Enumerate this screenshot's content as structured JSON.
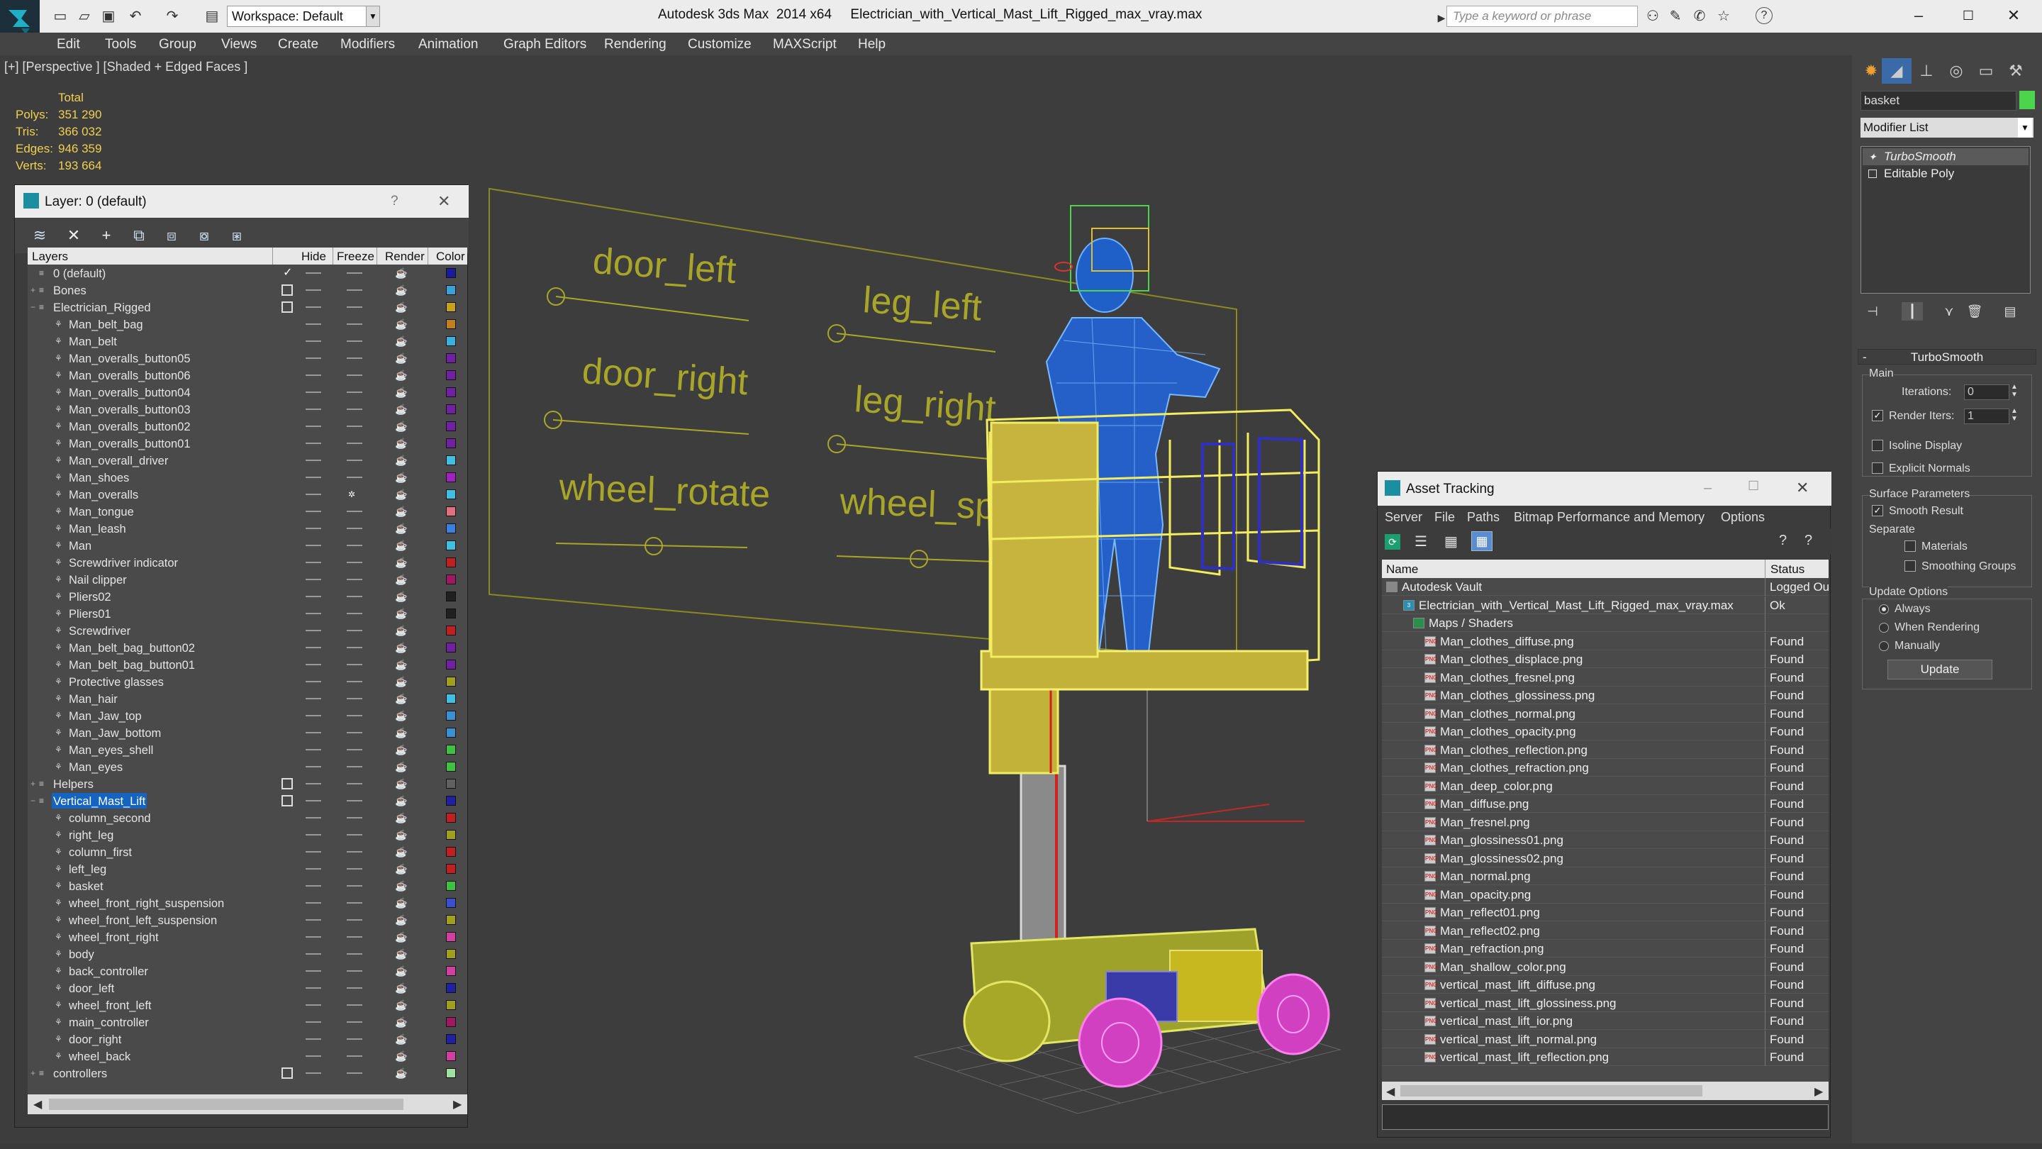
{
  "app": {
    "window_title": "Autodesk 3ds Max  2014 x64     Electrician_with_Vertical_Mast_Lift_Rigged_max_vray.max",
    "workspace": "Workspace: Default",
    "search_placeholder": "Type a keyword or phrase"
  },
  "menu": [
    "Edit",
    "Tools",
    "Group",
    "Views",
    "Create",
    "Modifiers",
    "Animation",
    "Graph Editors",
    "Rendering",
    "Customize",
    "MAXScript",
    "Help"
  ],
  "viewport": {
    "label": "[+] [Perspective ] [Shaded + Edged Faces ]",
    "stats": {
      "header": "Total",
      "rows": [
        {
          "label": "Polys:",
          "value": "351 290"
        },
        {
          "label": "Tris:",
          "value": "366 032"
        },
        {
          "label": "Edges:",
          "value": "946 359"
        },
        {
          "label": "Verts:",
          "value": "193 664"
        }
      ]
    },
    "rig_labels": [
      "door_left",
      "leg_left",
      "door_right",
      "leg_right",
      "wheel_rotate",
      "wheel_spin"
    ]
  },
  "layer_window": {
    "title": "Layer: 0 (default)",
    "help": "?",
    "close": "✕",
    "columns": [
      "Layers",
      "Hide",
      "Freeze",
      "Render",
      "Color"
    ],
    "rows": [
      {
        "name": "0 (default)",
        "level": 0,
        "check": "✓",
        "color": "#1a1a9a",
        "icon": "layer"
      },
      {
        "name": "Bones",
        "level": 0,
        "check": "box",
        "color": "#3aa0d8",
        "expand": "+",
        "icon": "layer"
      },
      {
        "name": "Electrician_Rigged",
        "level": 0,
        "check": "box",
        "color": "#c8a020",
        "expand": "−",
        "icon": "layer"
      },
      {
        "name": "Man_belt_bag",
        "level": 1,
        "color": "#c08020"
      },
      {
        "name": "Man_belt",
        "level": 1,
        "color": "#3ab0e0"
      },
      {
        "name": "Man_overalls_button05",
        "level": 1,
        "color": "#7020a0"
      },
      {
        "name": "Man_overalls_button06",
        "level": 1,
        "color": "#7020a0"
      },
      {
        "name": "Man_overalls_button04",
        "level": 1,
        "color": "#7020a0"
      },
      {
        "name": "Man_overalls_button03",
        "level": 1,
        "color": "#7020a0"
      },
      {
        "name": "Man_overalls_button02",
        "level": 1,
        "color": "#7020a0"
      },
      {
        "name": "Man_overalls_button01",
        "level": 1,
        "color": "#7020a0"
      },
      {
        "name": "Man_overall_driver",
        "level": 1,
        "color": "#40c0e0"
      },
      {
        "name": "Man_shoes",
        "level": 1,
        "color": "#a020c0"
      },
      {
        "name": "Man_overalls",
        "level": 1,
        "color": "#40c0e0",
        "freeze": "✲"
      },
      {
        "name": "Man_tongue",
        "level": 1,
        "color": "#e07080"
      },
      {
        "name": "Man_leash",
        "level": 1,
        "color": "#3a80e0"
      },
      {
        "name": "Man",
        "level": 1,
        "color": "#40c0e0"
      },
      {
        "name": "Screwdriver indicator",
        "level": 1,
        "color": "#c02020"
      },
      {
        "name": "Nail clipper",
        "level": 1,
        "color": "#a01860"
      },
      {
        "name": "Pliers02",
        "level": 1,
        "color": "#202020"
      },
      {
        "name": "Pliers01",
        "level": 1,
        "color": "#202020"
      },
      {
        "name": "Screwdriver",
        "level": 1,
        "color": "#c02020"
      },
      {
        "name": "Man_belt_bag_button02",
        "level": 1,
        "color": "#7020a0"
      },
      {
        "name": "Man_belt_bag_button01",
        "level": 1,
        "color": "#7020a0"
      },
      {
        "name": "Protective glasses",
        "level": 1,
        "color": "#a0a020"
      },
      {
        "name": "Man_hair",
        "level": 1,
        "color": "#40c0e0"
      },
      {
        "name": "Man_Jaw_top",
        "level": 1,
        "color": "#3a90d0"
      },
      {
        "name": "Man_Jaw_bottom",
        "level": 1,
        "color": "#3a90d0"
      },
      {
        "name": "Man_eyes_shell",
        "level": 1,
        "color": "#40c040"
      },
      {
        "name": "Man_eyes",
        "level": 1,
        "color": "#40c040"
      },
      {
        "name": "Helpers",
        "level": 0,
        "check": "box",
        "color": "#606060",
        "expand": "+",
        "icon": "layer"
      },
      {
        "name": "Vertical_Mast_Lift",
        "level": 0,
        "check": "box",
        "color": "#2020a0",
        "expand": "−",
        "icon": "layer",
        "selected": true
      },
      {
        "name": "column_second",
        "level": 1,
        "color": "#c02020"
      },
      {
        "name": "right_leg",
        "level": 1,
        "color": "#a0a020"
      },
      {
        "name": "column_first",
        "level": 1,
        "color": "#c02020"
      },
      {
        "name": "left_leg",
        "level": 1,
        "color": "#c02020"
      },
      {
        "name": "basket",
        "level": 1,
        "color": "#40c040"
      },
      {
        "name": "wheel_front_right_suspension",
        "level": 1,
        "color": "#3a50d0"
      },
      {
        "name": "wheel_front_left_suspension",
        "level": 1,
        "color": "#a0a020"
      },
      {
        "name": "wheel_front_right",
        "level": 1,
        "color": "#d040a0"
      },
      {
        "name": "body",
        "level": 1,
        "color": "#a0a020"
      },
      {
        "name": "back_controller",
        "level": 1,
        "color": "#d040a0"
      },
      {
        "name": "door_left",
        "level": 1,
        "color": "#2020a0"
      },
      {
        "name": "wheel_front_left",
        "level": 1,
        "color": "#a0a020"
      },
      {
        "name": "main_controller",
        "level": 1,
        "color": "#a01860"
      },
      {
        "name": "door_right",
        "level": 1,
        "color": "#2020a0"
      },
      {
        "name": "wheel_back",
        "level": 1,
        "color": "#d040a0"
      },
      {
        "name": "controllers",
        "level": 0,
        "check": "box",
        "color": "#a0e0a0",
        "expand": "+",
        "icon": "layer"
      }
    ]
  },
  "asset_window": {
    "title": "Asset Tracking",
    "menu": [
      "Server",
      "File",
      "Paths",
      "Bitmap Performance and Memory",
      "Options"
    ],
    "columns": [
      "Name",
      "Status"
    ],
    "rows": [
      {
        "name": "Autodesk Vault",
        "status": "Logged Ou",
        "level": 0,
        "icon": "vault"
      },
      {
        "name": "Electrician_with_Vertical_Mast_Lift_Rigged_max_vray.max",
        "status": "Ok",
        "level": 1,
        "icon": "max"
      },
      {
        "name": "Maps / Shaders",
        "status": "",
        "level": 2,
        "icon": "maps"
      },
      {
        "name": "Man_clothes_diffuse.png",
        "status": "Found",
        "level": 3,
        "icon": "png"
      },
      {
        "name": "Man_clothes_displace.png",
        "status": "Found",
        "level": 3,
        "icon": "png"
      },
      {
        "name": "Man_clothes_fresnel.png",
        "status": "Found",
        "level": 3,
        "icon": "png"
      },
      {
        "name": "Man_clothes_glossiness.png",
        "status": "Found",
        "level": 3,
        "icon": "png"
      },
      {
        "name": "Man_clothes_normal.png",
        "status": "Found",
        "level": 3,
        "icon": "png"
      },
      {
        "name": "Man_clothes_opacity.png",
        "status": "Found",
        "level": 3,
        "icon": "png"
      },
      {
        "name": "Man_clothes_reflection.png",
        "status": "Found",
        "level": 3,
        "icon": "png"
      },
      {
        "name": "Man_clothes_refraction.png",
        "status": "Found",
        "level": 3,
        "icon": "png"
      },
      {
        "name": "Man_deep_color.png",
        "status": "Found",
        "level": 3,
        "icon": "png"
      },
      {
        "name": "Man_diffuse.png",
        "status": "Found",
        "level": 3,
        "icon": "png"
      },
      {
        "name": "Man_fresnel.png",
        "status": "Found",
        "level": 3,
        "icon": "png"
      },
      {
        "name": "Man_glossiness01.png",
        "status": "Found",
        "level": 3,
        "icon": "png"
      },
      {
        "name": "Man_glossiness02.png",
        "status": "Found",
        "level": 3,
        "icon": "png"
      },
      {
        "name": "Man_normal.png",
        "status": "Found",
        "level": 3,
        "icon": "png"
      },
      {
        "name": "Man_opacity.png",
        "status": "Found",
        "level": 3,
        "icon": "png"
      },
      {
        "name": "Man_reflect01.png",
        "status": "Found",
        "level": 3,
        "icon": "png"
      },
      {
        "name": "Man_reflect02.png",
        "status": "Found",
        "level": 3,
        "icon": "png"
      },
      {
        "name": "Man_refraction.png",
        "status": "Found",
        "level": 3,
        "icon": "png"
      },
      {
        "name": "Man_shallow_color.png",
        "status": "Found",
        "level": 3,
        "icon": "png"
      },
      {
        "name": "vertical_mast_lift_diffuse.png",
        "status": "Found",
        "level": 3,
        "icon": "png"
      },
      {
        "name": "vertical_mast_lift_glossiness.png",
        "status": "Found",
        "level": 3,
        "icon": "png"
      },
      {
        "name": "vertical_mast_lift_ior.png",
        "status": "Found",
        "level": 3,
        "icon": "png"
      },
      {
        "name": "vertical_mast_lift_normal.png",
        "status": "Found",
        "level": 3,
        "icon": "png"
      },
      {
        "name": "vertical_mast_lift_reflection.png",
        "status": "Found",
        "level": 3,
        "icon": "png"
      }
    ]
  },
  "command_panel": {
    "object_name": "basket",
    "object_color": "#4cd44c",
    "modifier_list": "Modifier List",
    "stack": [
      "TurboSmooth",
      "Editable Poly"
    ],
    "turbosmooth": {
      "rollout": "TurboSmooth",
      "main_group": "Main",
      "iterations_label": "Iterations:",
      "iterations_value": "0",
      "render_iters_label": "Render Iters:",
      "render_iters_value": "1",
      "render_iters_checked": true,
      "isoline_label": "Isoline Display",
      "explicit_normals_label": "Explicit Normals",
      "surface_group": "Surface Parameters",
      "smooth_result_label": "Smooth Result",
      "separate_label": "Separate",
      "materials_label": "Materials",
      "smoothing_groups_label": "Smoothing Groups",
      "update_group": "Update Options",
      "always_label": "Always",
      "when_rendering_label": "When Rendering",
      "manually_label": "Manually",
      "update_button": "Update"
    }
  }
}
